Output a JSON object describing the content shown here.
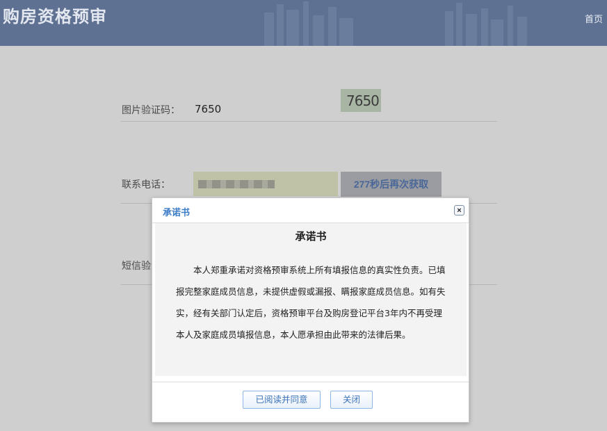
{
  "header": {
    "title": "购房资格预审",
    "home_link": "首页"
  },
  "form": {
    "captcha_label": "图片验证码：",
    "captcha_value": "7650",
    "captcha_image_text": "7650",
    "phone_label": "联系电话：",
    "resend_button": "277秒后再次获取",
    "sms_label": "短信验证码："
  },
  "modal": {
    "header_title": "承诺书",
    "close_icon": "×",
    "doc_title": "承诺书",
    "doc_text": "本人郑重承诺对资格预审系统上所有填报信息的真实性负责。已填报完整家庭成员信息，未提供虚假或漏报、瞒报家庭成员信息。如有失实，经有关部门认定后，资格预审平台及购房登记平台3年内不再受理本人及家庭成员填报信息，本人愿承担由此带来的法律后果。",
    "agree_button": "已阅读并同意",
    "close_button": "关闭"
  }
}
